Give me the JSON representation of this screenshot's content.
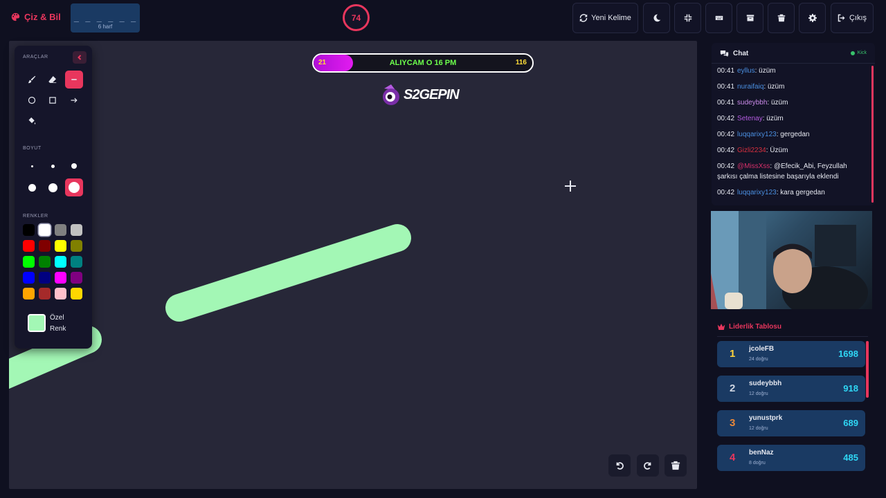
{
  "app": {
    "title": "Çiz & Bil",
    "accent": "#e8365d"
  },
  "word": {
    "dashes": "_ _ _ _ _ _",
    "hint": "6 harf"
  },
  "timer": {
    "value": "74"
  },
  "toolbar": {
    "new_word_label": "Yeni Kelime",
    "exit_label": "Çıkış"
  },
  "canvas": {
    "progress": {
      "left_value": "21",
      "message": "ALIYCAM O 16 PM",
      "right_value": "116",
      "fill_fraction": 0.18
    },
    "logo_text": "S2GEPIN",
    "stroke_color": "#a3f7b5"
  },
  "tools": {
    "section_tools": "ARAÇLAR",
    "section_size": "BOYUT",
    "section_colors": "RENKLER",
    "custom_color_label": "Özel Renk",
    "custom_color": "#a3f7b5",
    "colors": [
      "#000000",
      "#ffffff",
      "#808080",
      "#c0c0c0",
      "#ff0000",
      "#800000",
      "#ffff00",
      "#808000",
      "#00ff00",
      "#008000",
      "#00ffff",
      "#008080",
      "#0000ff",
      "#000080",
      "#ff00ff",
      "#800080",
      "#ffa500",
      "#a52a2a",
      "#ffc0cb",
      "#ffd700"
    ]
  },
  "chat": {
    "title": "Chat",
    "status": "Kick",
    "messages": [
      {
        "time": "00:41",
        "user": "eyllus",
        "user_color": "#4a8fe0",
        "text": ": üzüm"
      },
      {
        "time": "00:41",
        "user": "nuraifaiq",
        "user_color": "#4a8fe0",
        "text": ": üzüm"
      },
      {
        "time": "00:41",
        "user": "sudeybbh",
        "user_color": "#c98ae8",
        "text": ": üzüm"
      },
      {
        "time": "00:42",
        "user": "Setenay",
        "user_color": "#b45be0",
        "text": ": üzüm"
      },
      {
        "time": "00:42",
        "user": "luqqarixy123",
        "user_color": "#4a8fe0",
        "text": ": gergedan"
      },
      {
        "time": "00:42",
        "user": "Gizli2234",
        "user_color": "#d8303f",
        "text": ": Üzüm"
      },
      {
        "time": "00:42",
        "user": "@MissXss",
        "user_color": "#d8306a",
        "text": ": @Efecik_Abi, Feyzullah şarkısı çalma listesine başarıyla eklendi"
      },
      {
        "time": "00:42",
        "user": "luqqarixy123",
        "user_color": "#4a8fe0",
        "text": ": kara gergedan"
      }
    ]
  },
  "leaderboard": {
    "title": "Liderlik Tablosu",
    "rows": [
      {
        "rank": "1",
        "rank_color": "#ffd43b",
        "name": "jcoleFB",
        "sub": "24 doğru",
        "score": "1698"
      },
      {
        "rank": "2",
        "rank_color": "#cfd6e3",
        "name": "sudeybbh",
        "sub": "12 doğru",
        "score": "918"
      },
      {
        "rank": "3",
        "rank_color": "#e8883a",
        "name": "yunustprk",
        "sub": "12 doğru",
        "score": "689"
      },
      {
        "rank": "4",
        "rank_color": "#e8365d",
        "name": "benNaz",
        "sub": "8 doğru",
        "score": "485"
      }
    ]
  }
}
